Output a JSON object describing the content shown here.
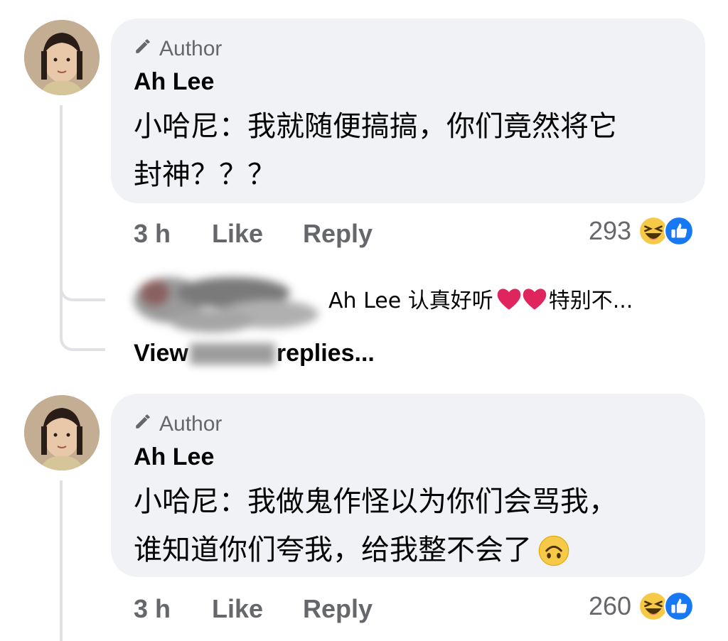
{
  "comments": [
    {
      "badge": "Author",
      "name": "Ah Lee",
      "line1": "小哈尼：我就随便搞搞，你们竟然将它",
      "line2": "封神？？？",
      "time": "3 h",
      "like": "Like",
      "reply": "Reply",
      "reaction_count": "293",
      "reactions": [
        "haha-emoji",
        "like-emoji"
      ]
    },
    {
      "badge": "Author",
      "name": "Ah Lee",
      "line1": "小哈尼：我做鬼作怪以为你们会骂我，",
      "line2": "谁知道你们夸我，给我整不会了",
      "time": "3 h",
      "like": "Like",
      "reply": "Reply",
      "reaction_count": "260",
      "reactions": [
        "haha-emoji",
        "like-emoji"
      ]
    }
  ],
  "reply_preview": {
    "text_a": "Ah Lee 认真好听",
    "text_b": "特别不...",
    "view_more": "replies..."
  },
  "colors": {
    "bubble": "#f0f2f5",
    "meta": "#65676b",
    "like_blue": "#1877f2",
    "heart": "#e0245e"
  }
}
